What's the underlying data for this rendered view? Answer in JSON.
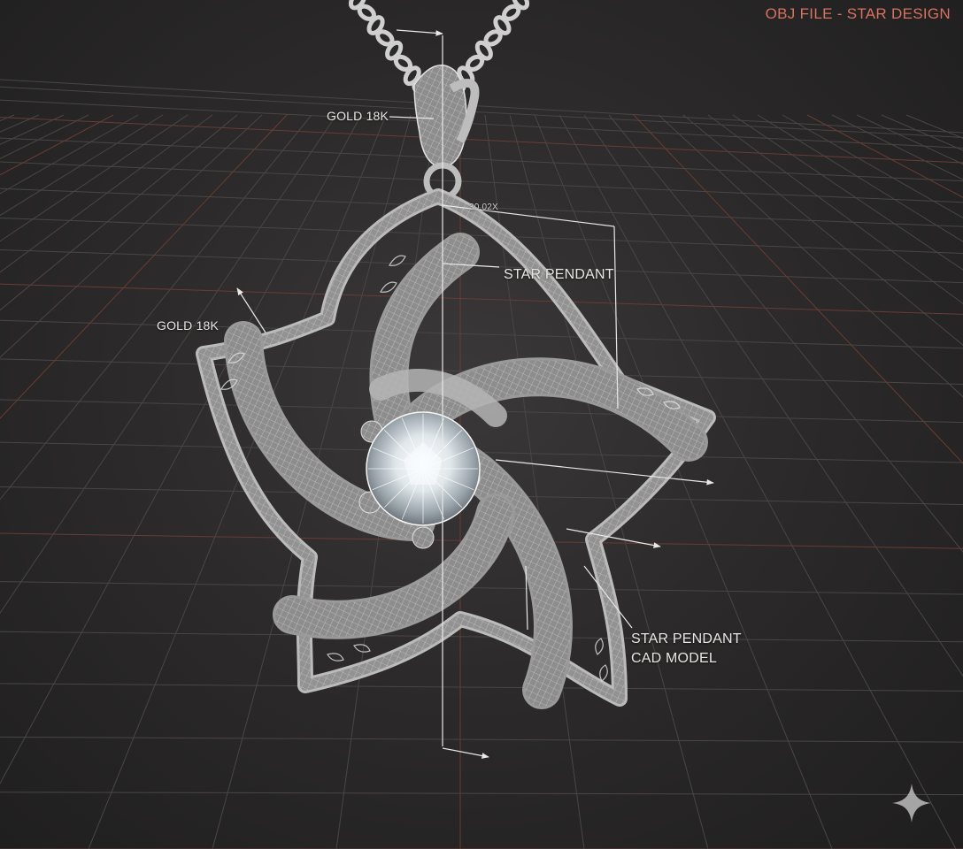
{
  "header": {
    "title": "OBJ FILE - STAR DESIGN"
  },
  "annotations": {
    "gold_top": "GOLD 18K",
    "gold_left": "GOLD 18K",
    "star_pendant": "STAR PENDANT",
    "dimension": "30.02X",
    "cad_line1": "STAR PENDANT",
    "cad_line2": "CAD MODEL"
  },
  "model": {
    "material": "gold-18k",
    "gem": "round-brilliant-diamond",
    "view": "wireframe"
  },
  "icons": {
    "watermark": "sparkle-star-icon"
  },
  "colors": {
    "background": "#2a2828",
    "grid_line": "#4a4646",
    "grid_accent": "#6a3c34",
    "wireframe": "#c9c9c9",
    "header_accent": "#d8725f"
  }
}
